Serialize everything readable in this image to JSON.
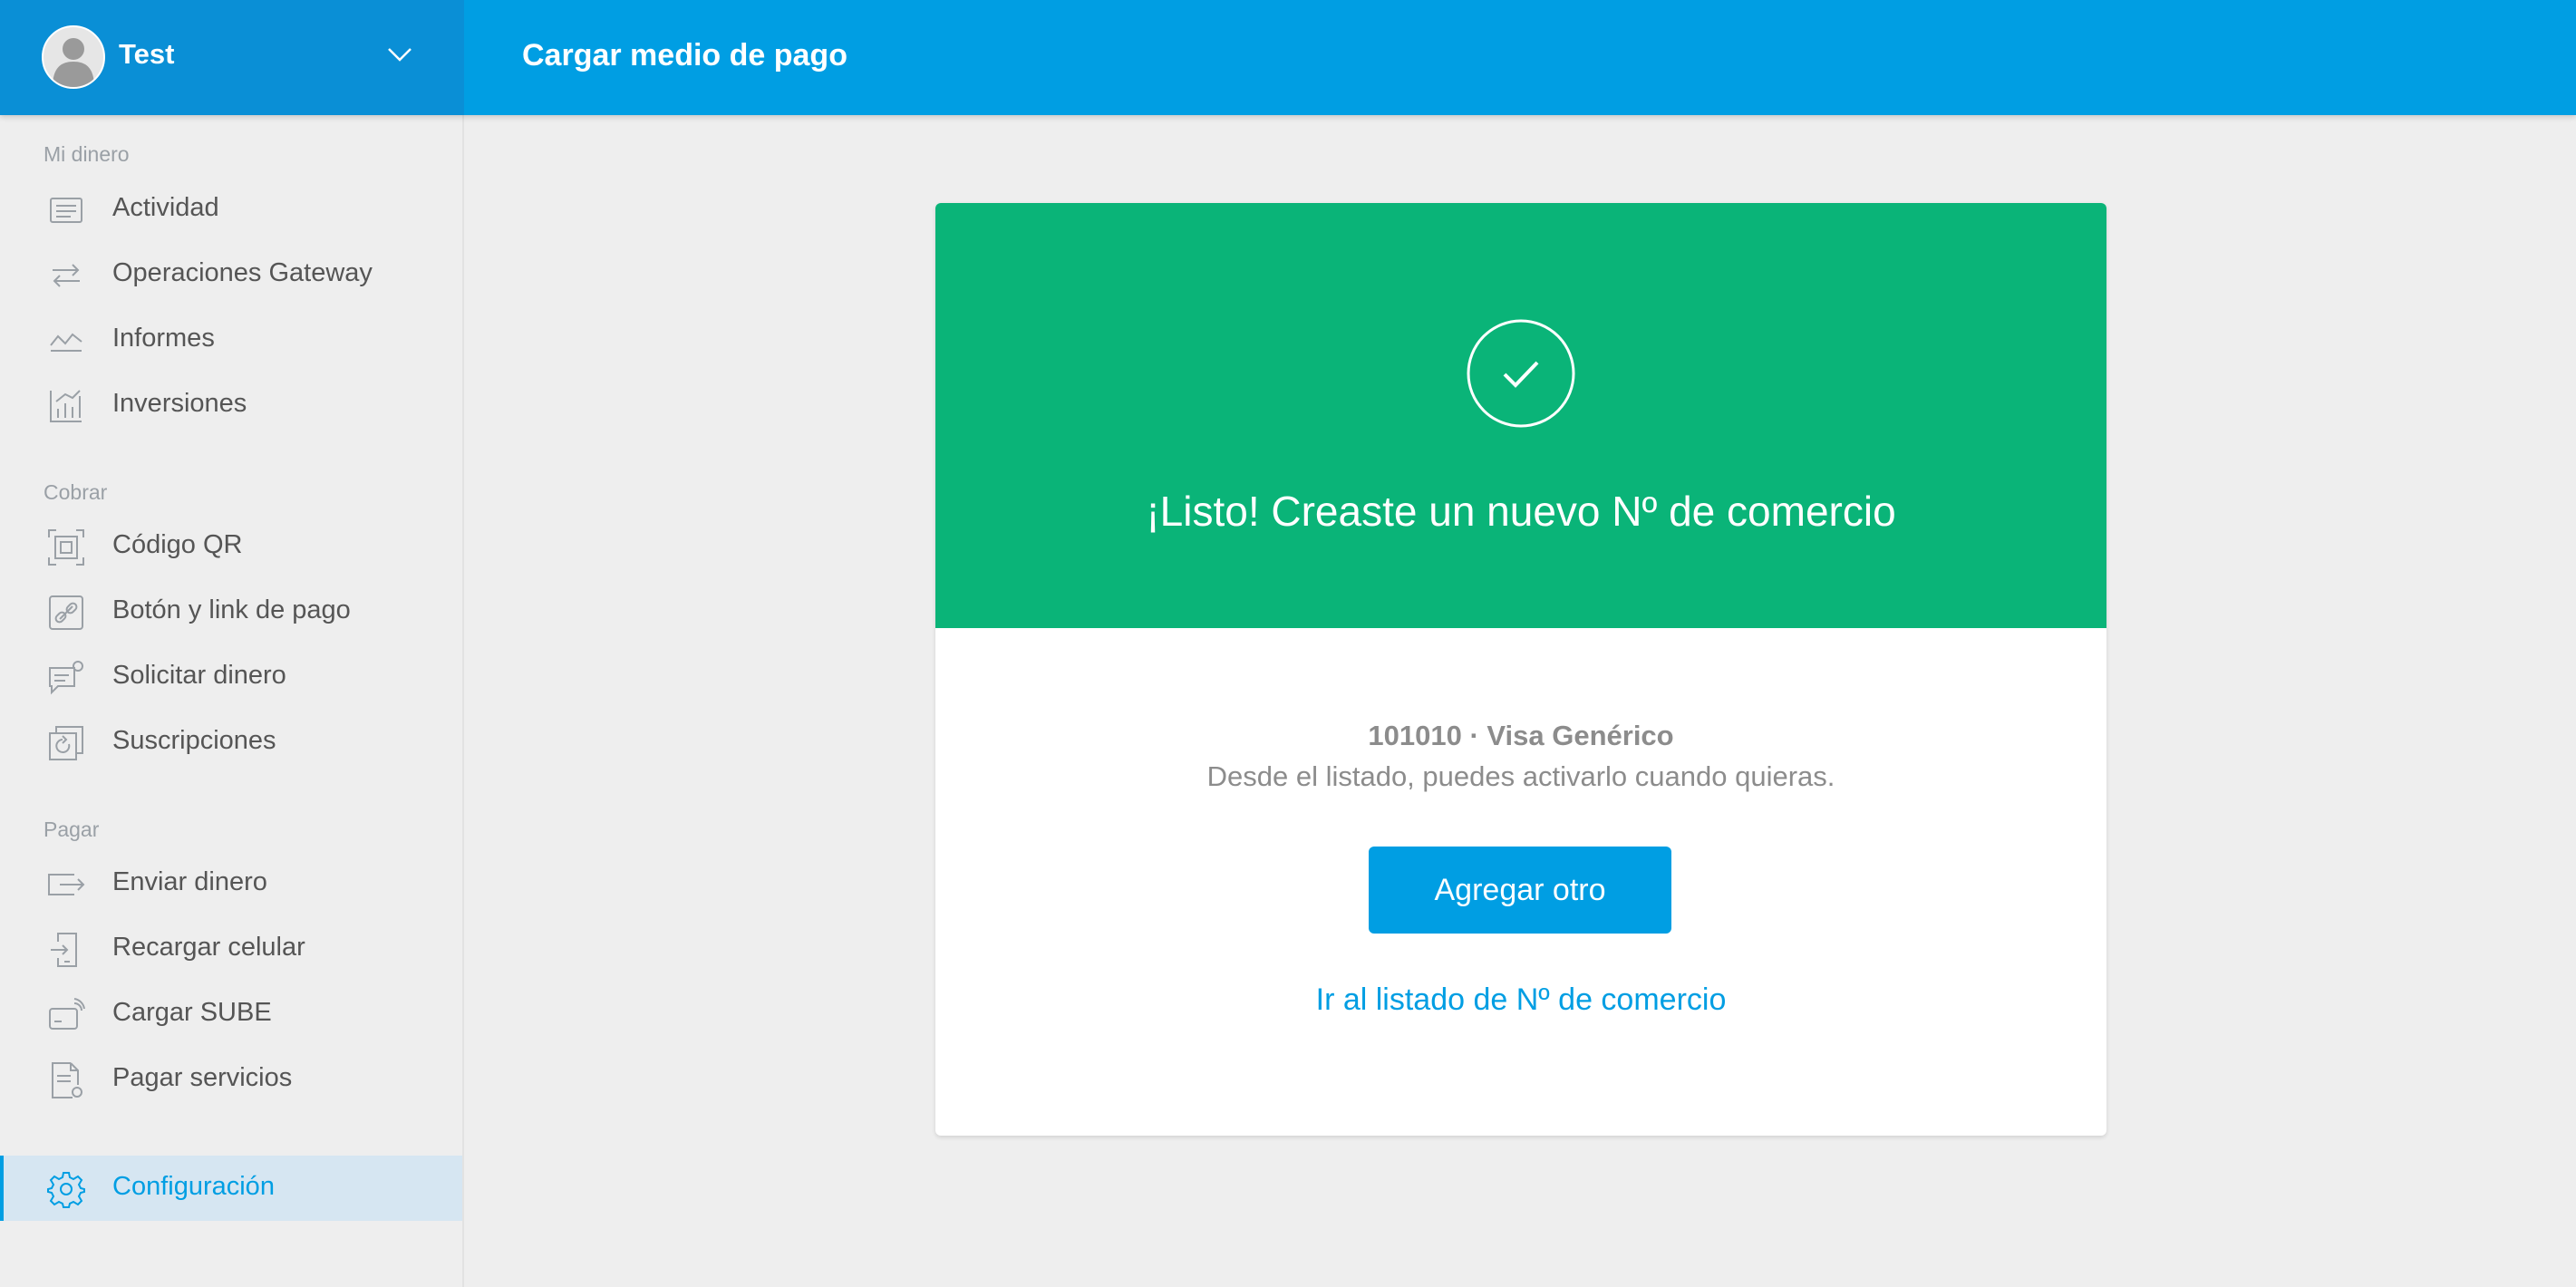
{
  "header": {
    "user_name": "Test",
    "page_title": "Cargar medio de pago"
  },
  "sidebar": {
    "sections": [
      {
        "label": "Mi dinero",
        "items": [
          {
            "label": "Actividad",
            "icon": "activity-list-icon"
          },
          {
            "label": "Operaciones Gateway",
            "icon": "transfer-arrows-icon"
          },
          {
            "label": "Informes",
            "icon": "trend-line-icon"
          },
          {
            "label": "Inversiones",
            "icon": "bar-chart-icon"
          }
        ]
      },
      {
        "label": "Cobrar",
        "items": [
          {
            "label": "Código QR",
            "icon": "qr-code-icon"
          },
          {
            "label": "Botón y link de pago",
            "icon": "link-icon"
          },
          {
            "label": "Solicitar dinero",
            "icon": "request-money-icon"
          },
          {
            "label": "Suscripciones",
            "icon": "subscription-icon"
          }
        ]
      },
      {
        "label": "Pagar",
        "items": [
          {
            "label": "Enviar dinero",
            "icon": "send-money-icon"
          },
          {
            "label": "Recargar celular",
            "icon": "phone-recharge-icon"
          },
          {
            "label": "Cargar SUBE",
            "icon": "card-load-icon"
          },
          {
            "label": "Pagar servicios",
            "icon": "bill-icon"
          }
        ]
      }
    ],
    "settings": {
      "label": "Configuración",
      "icon": "gear-icon",
      "active": true
    }
  },
  "card": {
    "title": "¡Listo! Creaste un nuevo Nº de comercio",
    "merchant_number": "101010",
    "merchant_separator": "·",
    "merchant_name": "Visa Genérico",
    "description": "Desde el listado, puedes activarlo cuando quieras.",
    "primary_button": "Agregar otro",
    "link": "Ir al listado de Nº de comercio"
  },
  "colors": {
    "brand_blue": "#009ee3",
    "user_block_blue": "#0a8fd6",
    "success_green": "#0ab478",
    "background": "#eeeeee",
    "active_nav_bg": "#d6e6f2"
  }
}
